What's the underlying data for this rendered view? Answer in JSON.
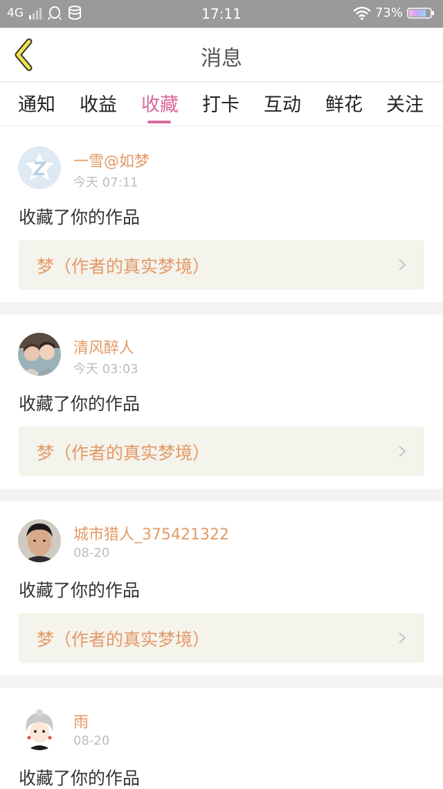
{
  "statusbar": {
    "network": "4G",
    "time": "17:11",
    "battery": "73%"
  },
  "header": {
    "title": "消息",
    "back_icon": "chevron-left-icon"
  },
  "tabs": [
    {
      "label": "通知",
      "active": false
    },
    {
      "label": "收益",
      "active": false
    },
    {
      "label": "收藏",
      "active": true
    },
    {
      "label": "打卡",
      "active": false
    },
    {
      "label": "互动",
      "active": false
    },
    {
      "label": "鲜花",
      "active": false
    },
    {
      "label": "关注",
      "active": false
    }
  ],
  "messages": [
    {
      "user": "一雪@如梦",
      "time": "今天 07:11",
      "action": "收藏了你的作品",
      "work": "梦（作者的真实梦境）"
    },
    {
      "user": "清风醉人",
      "time": "今天 03:03",
      "action": "收藏了你的作品",
      "work": "梦（作者的真实梦境）"
    },
    {
      "user": "城市猎人_375421322",
      "time": "08-20",
      "action": "收藏了你的作品",
      "work": "梦（作者的真实梦境）"
    },
    {
      "user": "雨",
      "time": "08-20",
      "action": "收藏了你的作品"
    }
  ],
  "colors": {
    "accent": "#d9699a",
    "username": "#e49966",
    "back_icon": "#f2e24a"
  }
}
